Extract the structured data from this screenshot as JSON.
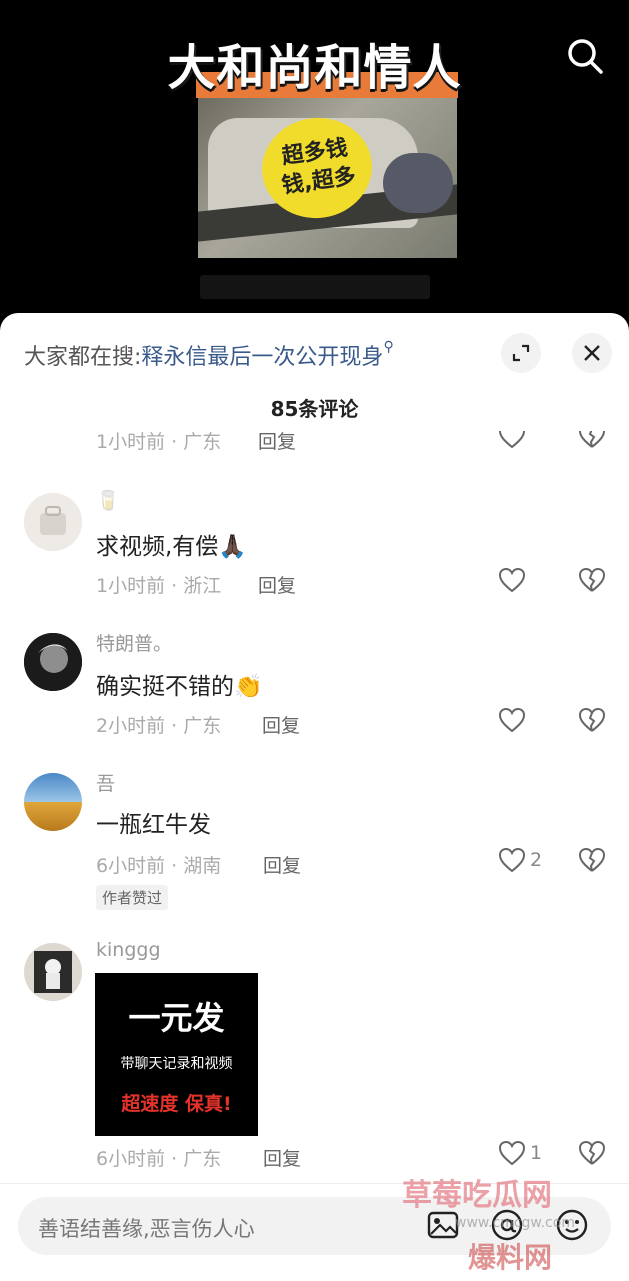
{
  "video": {
    "title": "大和尚和情人",
    "sticker_text": "超多钱\n钱,超多"
  },
  "colors": {
    "accent_link": "#3a5a8c",
    "title_highlight": "#e87a3a",
    "sticker": "#f1dc2b"
  },
  "sheet": {
    "suggest_prefix": "大家都在搜:",
    "suggest_link": "释永信最后一次公开现身",
    "count_label": "85条评论",
    "reply_label": "回复"
  },
  "comments": [
    {
      "meta": "1小时前 · 广东",
      "reply": "回复"
    },
    {
      "name": "🥛",
      "text": "求视频,有偿🙏🏿",
      "meta": "1小时前 · 浙江",
      "reply": "回复",
      "likes": ""
    },
    {
      "name": "特朗普。",
      "text": "确实挺不错的👏",
      "meta": "2小时前 · 广东",
      "reply": "回复",
      "likes": ""
    },
    {
      "name": "吾",
      "text": "一瓶红牛发",
      "meta": "6小时前 · 湖南",
      "reply": "回复",
      "likes": "2",
      "badge": "作者赞过"
    },
    {
      "name": "kinggg",
      "image_text": {
        "line1": "一元发",
        "line2": "带聊天记录和视频",
        "line3": "超速度 保真!"
      },
      "meta": "6小时前 · 广东",
      "reply": "回复",
      "likes": "1"
    }
  ],
  "input": {
    "placeholder": "善语结善缘,恶言伤人心"
  },
  "watermark": {
    "line1": "草莓吃瓜网",
    "line2": "www.cmcgw.com",
    "line3": "爆料网"
  },
  "icons": [
    "search-icon",
    "expand-icon",
    "close-icon",
    "heart-icon",
    "broken-heart-icon",
    "image-icon",
    "at-icon",
    "emoji-icon"
  ]
}
